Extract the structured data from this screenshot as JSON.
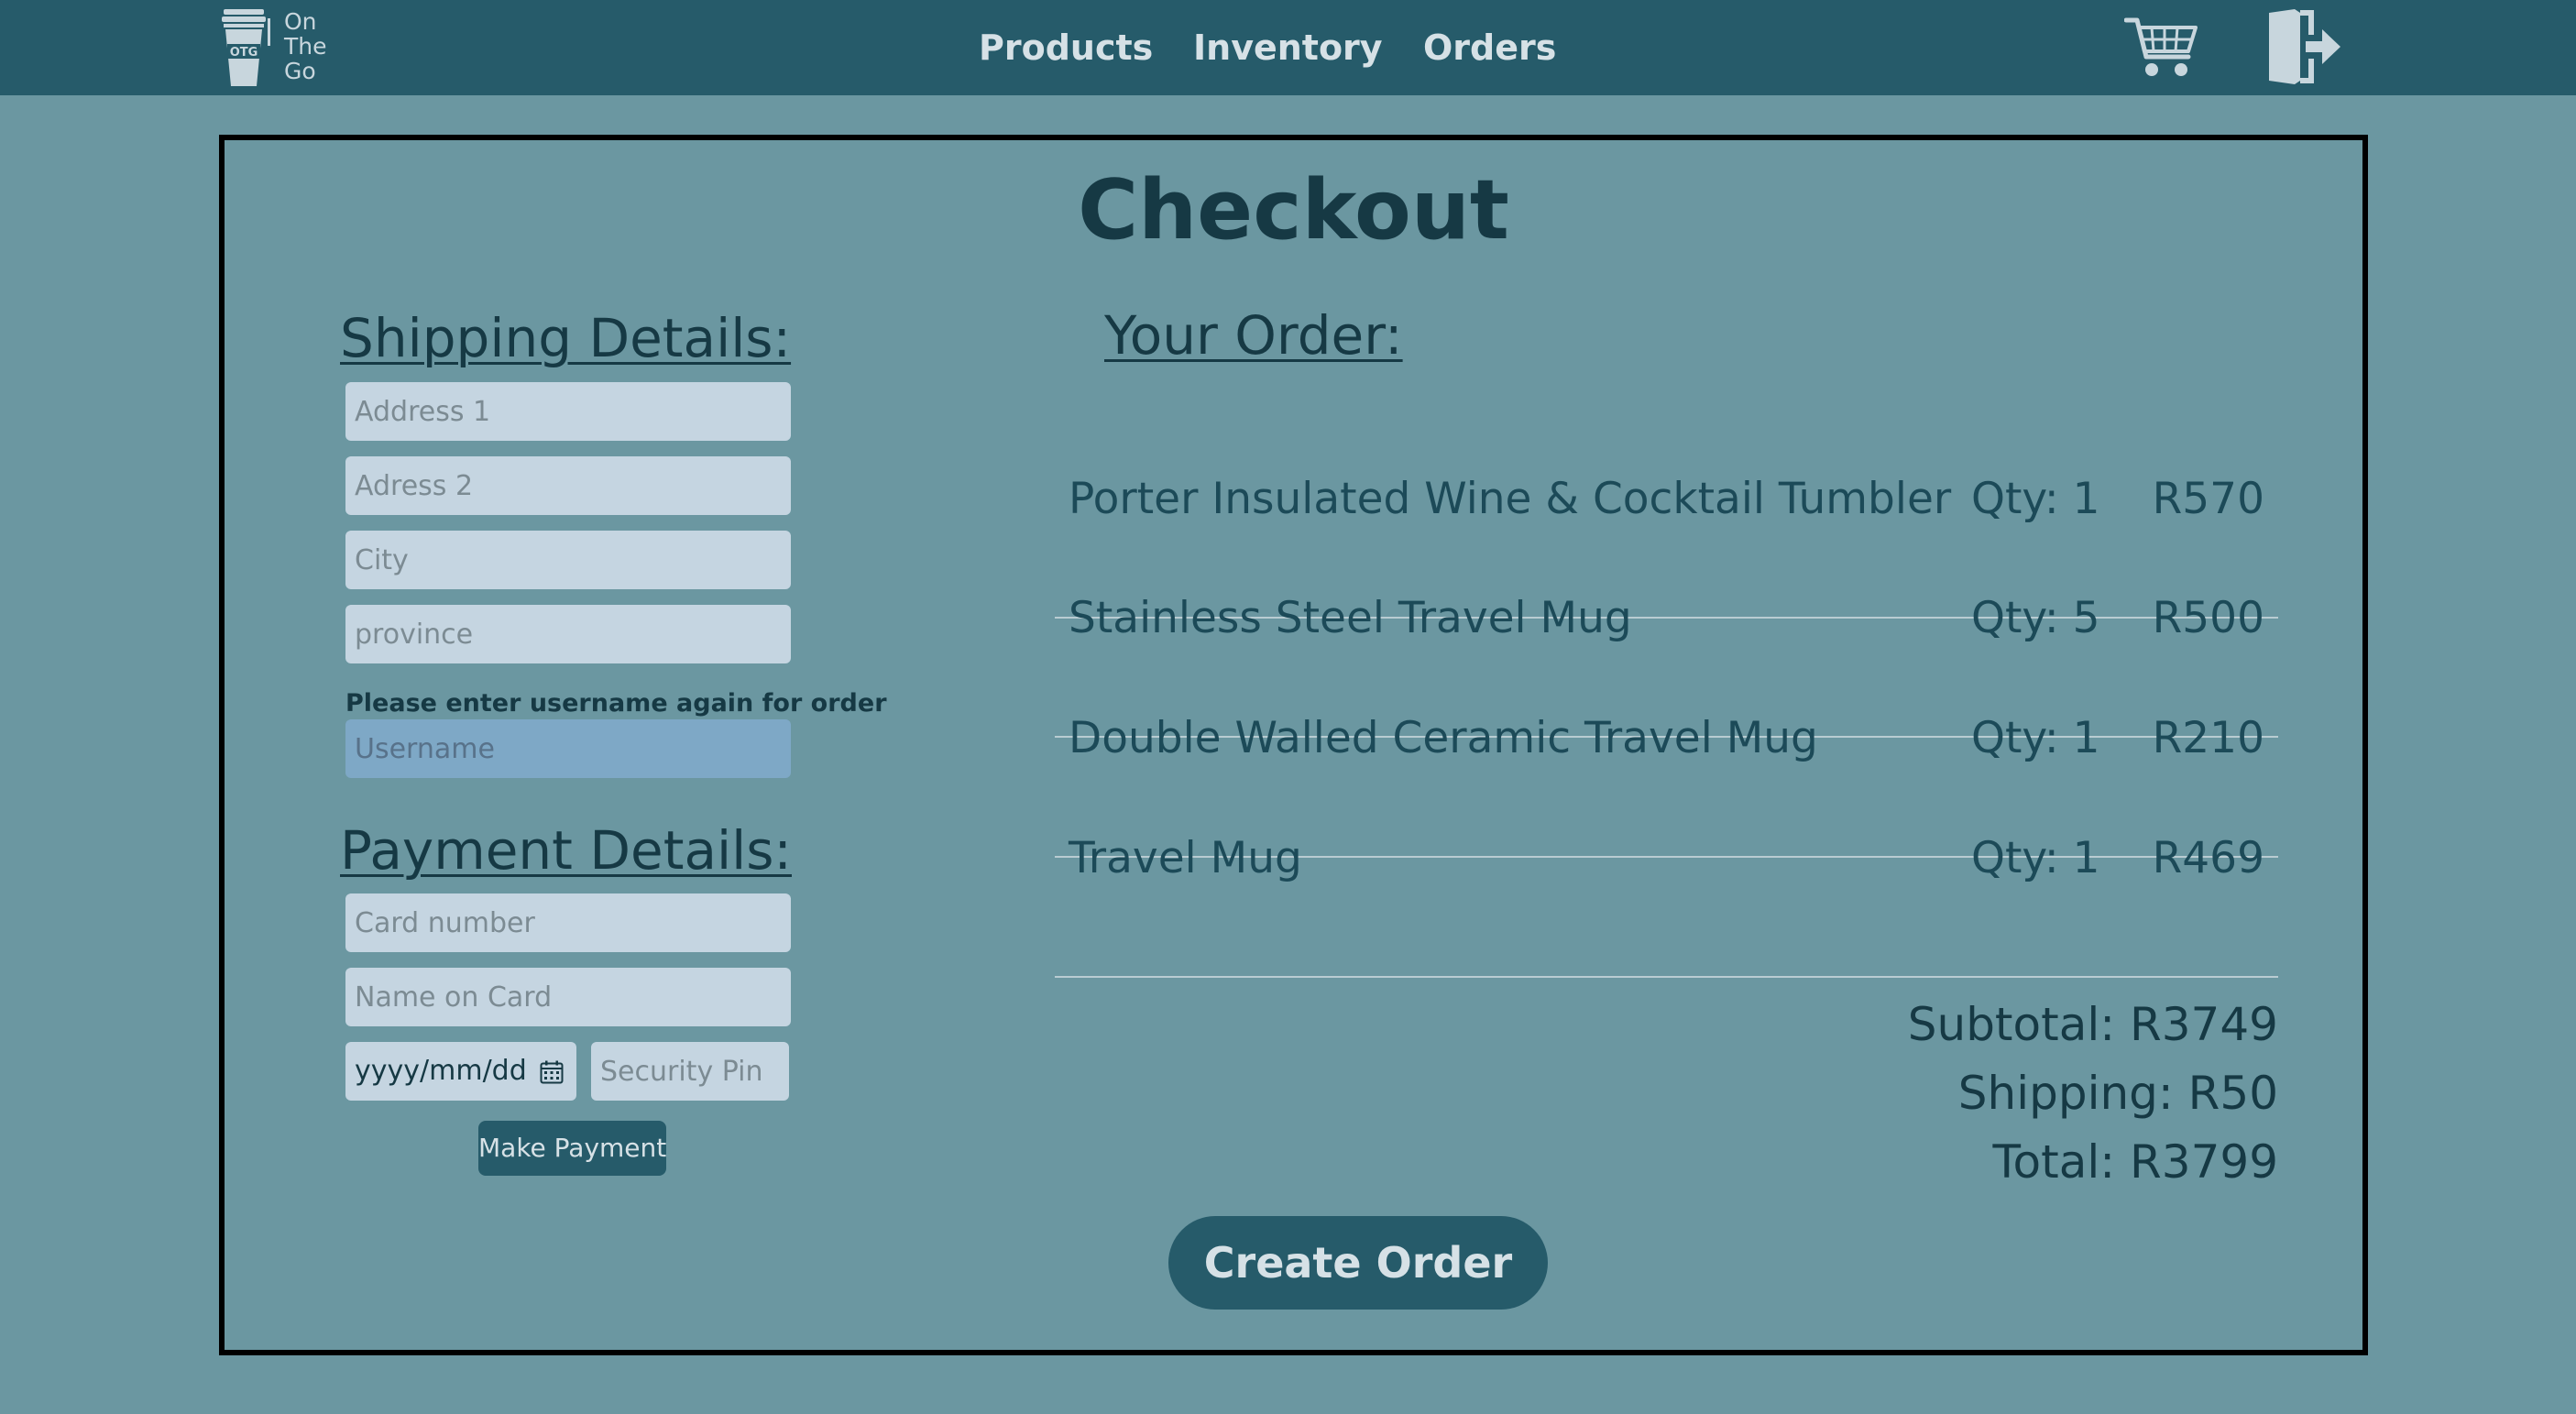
{
  "brand": {
    "logo_badge": "OTG",
    "logo_lines": [
      "On",
      "The",
      "Go"
    ]
  },
  "nav": {
    "links": [
      "Products",
      "Inventory",
      "Orders"
    ],
    "cart_icon": "cart-icon",
    "logout_icon": "logout-icon"
  },
  "page": {
    "title": "Checkout"
  },
  "shipping": {
    "heading": "Shipping Details:",
    "address1_placeholder": "Address 1",
    "address2_placeholder": "Adress 2",
    "city_placeholder": "City",
    "province_placeholder": "province",
    "username_note": "Please enter username again for order",
    "username_placeholder": "Username"
  },
  "payment": {
    "heading": "Payment Details:",
    "card_number_placeholder": "Card number",
    "name_on_card_placeholder": "Name on Card",
    "expiry_placeholder": "yyyy/mm/dd",
    "security_pin_placeholder": "Security Pin",
    "pay_button": "Make Payment"
  },
  "order": {
    "heading": "Your Order:",
    "items": [
      {
        "name": "Porter Insulated Wine & Cocktail Tumbler",
        "qty": "Qty: 1",
        "price": "R570"
      },
      {
        "name": "Stainless Steel Travel Mug",
        "qty": "Qty: 5",
        "price": "R500"
      },
      {
        "name": "Double Walled Ceramic Travel Mug",
        "qty": "Qty: 1",
        "price": "R210"
      },
      {
        "name": "Travel Mug",
        "qty": "Qty: 1",
        "price": "R469"
      }
    ],
    "subtotal": "Subtotal: R3749",
    "shipping": "Shipping: R50",
    "total": "Total: R3799",
    "create_button": "Create Order"
  },
  "colors": {
    "nav_bg": "#265b6a",
    "page_bg": "#6b97a1",
    "field_bg": "#c5d5e1",
    "username_field_bg": "#7ea8c6",
    "heading_text": "#163944",
    "button_bg": "#265b6a",
    "button_text": "#d6e1e6"
  }
}
